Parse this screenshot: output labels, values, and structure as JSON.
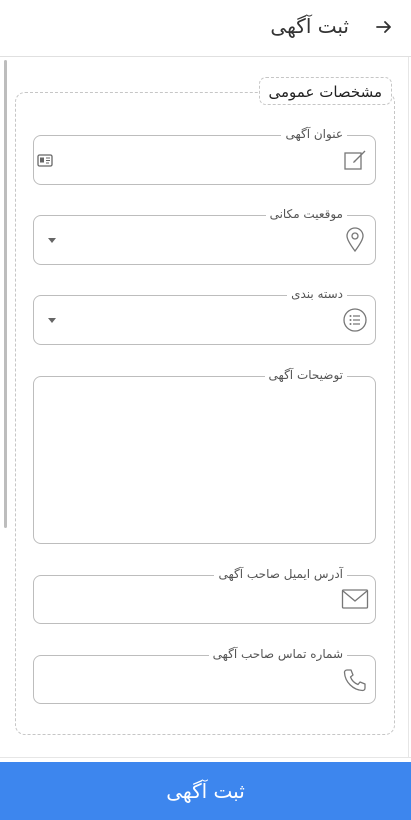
{
  "header": {
    "title": "ثبت آگهی",
    "back_icon": "arrow-right-icon"
  },
  "section": {
    "legend": "مشخصات عمومی"
  },
  "fields": {
    "title": {
      "label": "عنوان آگهی",
      "icon": "edit-icon",
      "value": ""
    },
    "location": {
      "label": "موقعیت مکانی",
      "icon": "location-pin-icon",
      "value": ""
    },
    "category": {
      "label": "دسته بندی",
      "icon": "list-icon",
      "value": ""
    },
    "description": {
      "label": "توضیحات آگهی",
      "value": ""
    },
    "email": {
      "label": "آدرس ایمیل صاحب آگهی",
      "icon": "mail-icon",
      "value": ""
    },
    "phone": {
      "label": "شماره تماس صاحب آگهی",
      "icon": "phone-icon",
      "value": ""
    }
  },
  "submit": {
    "label": "ثبت آگهی"
  },
  "colors": {
    "accent": "#3d86ee",
    "border": "#bdbdbd"
  }
}
